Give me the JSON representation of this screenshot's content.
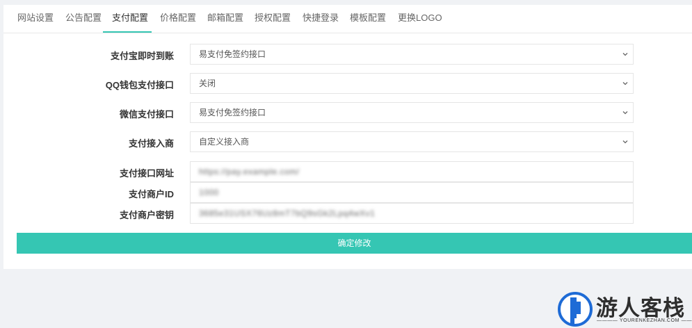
{
  "tabs": [
    {
      "label": "网站设置"
    },
    {
      "label": "公告配置"
    },
    {
      "label": "支付配置"
    },
    {
      "label": "价格配置"
    },
    {
      "label": "邮箱配置"
    },
    {
      "label": "授权配置"
    },
    {
      "label": "快捷登录"
    },
    {
      "label": "模板配置"
    },
    {
      "label": "更换LOGO"
    }
  ],
  "active_tab": "支付配置",
  "form": {
    "alipay": {
      "label": "支付宝即时到账",
      "value": "易支付免签约接口"
    },
    "qqpay": {
      "label": "QQ钱包支付接口",
      "value": "关闭"
    },
    "wxpay": {
      "label": "微信支付接口",
      "value": "易支付免签约接口"
    },
    "provider": {
      "label": "支付接入商",
      "value": "自定义接入商"
    },
    "api_url": {
      "label": "支付接口网址",
      "value": "https://pay.example.com/"
    },
    "merchant_id": {
      "label": "支付商户ID",
      "value": "1000"
    },
    "merchant_key": {
      "label": "支付商户密钥",
      "value": "3685e31USX76Uz8mT7bQ9sGk2Lpq4wXv1"
    }
  },
  "submit_label": "确定修改",
  "watermark": {
    "title": "游人客栈",
    "subtitle": "YOURENKEZHAN.COM",
    "accent": "#1e6bd6"
  },
  "colors": {
    "accent": "#35c6b3",
    "background": "#f0f2f5",
    "card": "#ffffff"
  }
}
